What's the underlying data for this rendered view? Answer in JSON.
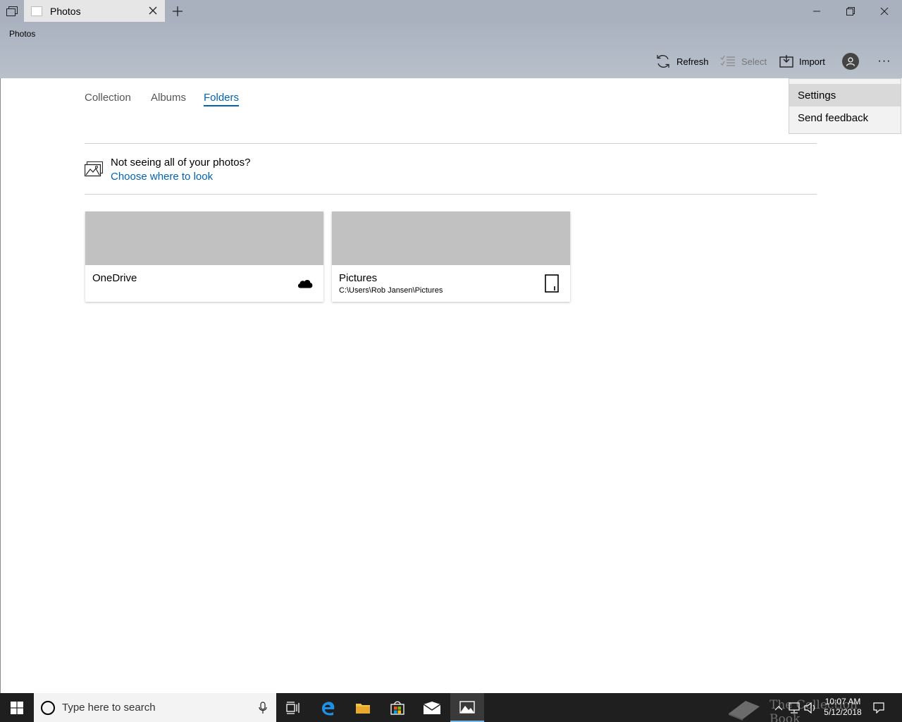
{
  "window": {
    "tab_title": "Photos",
    "app_title": "Photos"
  },
  "toolbar": {
    "refresh_label": "Refresh",
    "select_label": "Select",
    "import_label": "Import",
    "more_label": "···"
  },
  "nav": {
    "tabs": [
      {
        "label": "Collection",
        "active": false
      },
      {
        "label": "Albums",
        "active": false
      },
      {
        "label": "Folders",
        "active": true
      }
    ]
  },
  "notice": {
    "text": "Not seeing all of your photos?",
    "link": "Choose where to look"
  },
  "folders": [
    {
      "name": "OneDrive",
      "path": "",
      "icon": "cloud-icon"
    },
    {
      "name": "Pictures",
      "path": "C:\\Users\\Rob Jansen\\Pictures",
      "icon": "device-icon"
    }
  ],
  "menu": {
    "items": [
      {
        "label": "Settings",
        "highlighted": true
      },
      {
        "label": "Send feedback",
        "highlighted": false
      }
    ]
  },
  "taskbar": {
    "search_placeholder": "Type here to search",
    "time": "10:07 AM",
    "date": "5/12/2018",
    "watermark": "The Collection Book"
  },
  "colors": {
    "accent": "#0063b1",
    "header_bg": "#aab2c0",
    "tile_thumb": "#c1c1c1",
    "taskbar_bg": "#1f1f1f"
  }
}
